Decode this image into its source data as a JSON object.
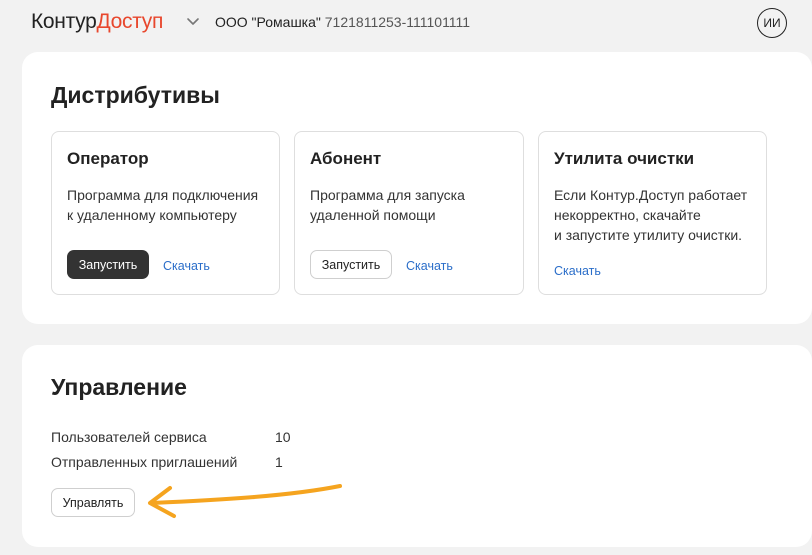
{
  "header": {
    "logo_part1": "Контур",
    "logo_part2": "Доступ",
    "org_name": "ООО \"Ромашка\"",
    "org_inn": "7121811253-111101111",
    "avatar_initials": "ИИ"
  },
  "distributions": {
    "title": "Дистрибутивы",
    "tiles": [
      {
        "title": "Оператор",
        "description": "Программа для подключения\nк удаленному компьютеру",
        "launch_label": "Запустить",
        "download_label": "Скачать"
      },
      {
        "title": "Абонент",
        "description": "Программа для запуска\nудаленной помощи",
        "launch_label": "Запустить",
        "download_label": "Скачать"
      },
      {
        "title": "Утилита очистки",
        "description": "Если Контур.Доступ работает\nнекорректно, скачайте\nи запустите утилиту очистки.",
        "download_label": "Скачать"
      }
    ]
  },
  "management": {
    "title": "Управление",
    "stats": [
      {
        "label": "Пользователей сервиса",
        "value": "10"
      },
      {
        "label": "Отправленных приглашений",
        "value": "1"
      }
    ],
    "manage_label": "Управлять"
  },
  "icons": {
    "org_dropdown": "chevron-down-icon",
    "annotation": "arrow-left-icon"
  },
  "colors": {
    "brand_red": "#e8472d",
    "link_blue": "#2b6ec9",
    "dark_button": "#333333",
    "annotation_orange": "#f5a41f"
  }
}
